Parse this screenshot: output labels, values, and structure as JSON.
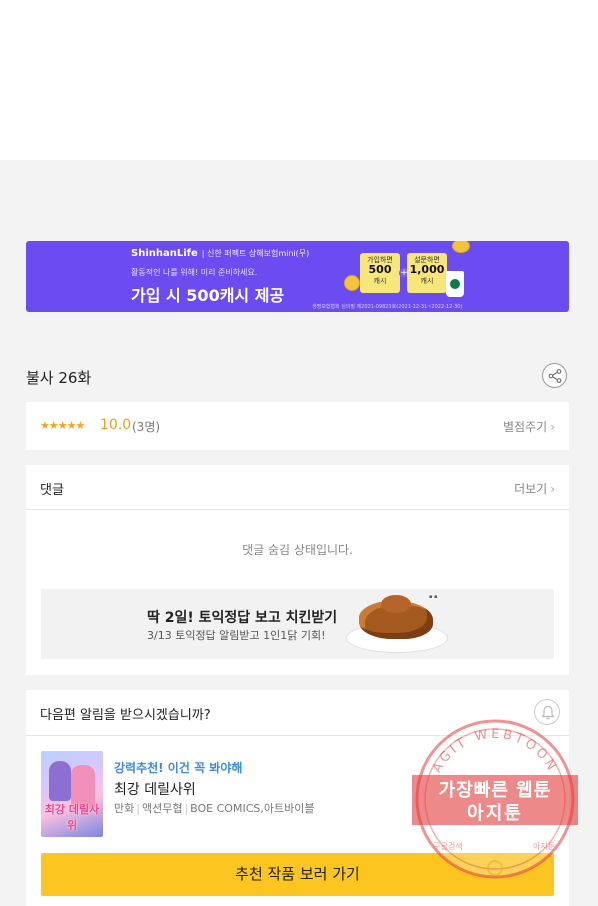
{
  "banner": {
    "brand": "ShinhanLife",
    "brand_sub": "| 신한 퍼펙트 상해보험mini(무)",
    "tagline": "활동적인 나를 위해! 미리 준비하세요.",
    "headline": "가입 시 500캐시 제공",
    "box1_top": "가입하면",
    "box1_amount": "500",
    "box1_unit": "캐시",
    "box2_top": "설문하면",
    "box2_amount": "1,000",
    "box2_unit": "캐시",
    "fine_print": "생명보험협회 심의필 제2021-09823호(2021-12-31~2022-12-30)"
  },
  "episode": {
    "title": "불사 26화"
  },
  "rating": {
    "stars": "★★★★★",
    "score": "10.0",
    "count": "(3명)",
    "rate_link": "별점주기"
  },
  "comments": {
    "heading": "댓글",
    "more_link": "더보기",
    "hidden_notice": "댓글 숨김 상태입니다."
  },
  "chicken_ad": {
    "title": "딱 2일! 토익정답 보고 치킨받기",
    "subtitle": "3/13 토익정답 알림받고 1인1닭 기회!"
  },
  "notify": {
    "question": "다음편 알림을 받으시겠습니까?",
    "promo": "강력추천! 이건 꼭 봐야해",
    "work_title": "최강 데릴사위",
    "genre1": "만화",
    "genre2": "액션무협",
    "publisher": "BOE COMICS,아트바이블",
    "cover_title": "최강 데릴사위",
    "cta": "추천 작품 보러 가기"
  },
  "watermark": {
    "arc_text": "AGIT WEBTOON",
    "line1": "가장빠른 웹툰",
    "line2": "아지툰",
    "bottom_left": "구글검색",
    "bottom_right": "아지툰"
  },
  "colors": {
    "banner_bg": "#6a4cf0",
    "star": "#f7a21b",
    "promo_blue": "#3b8be0",
    "cta_yellow": "#fcc51f",
    "stamp_red": "#e23b3b"
  }
}
